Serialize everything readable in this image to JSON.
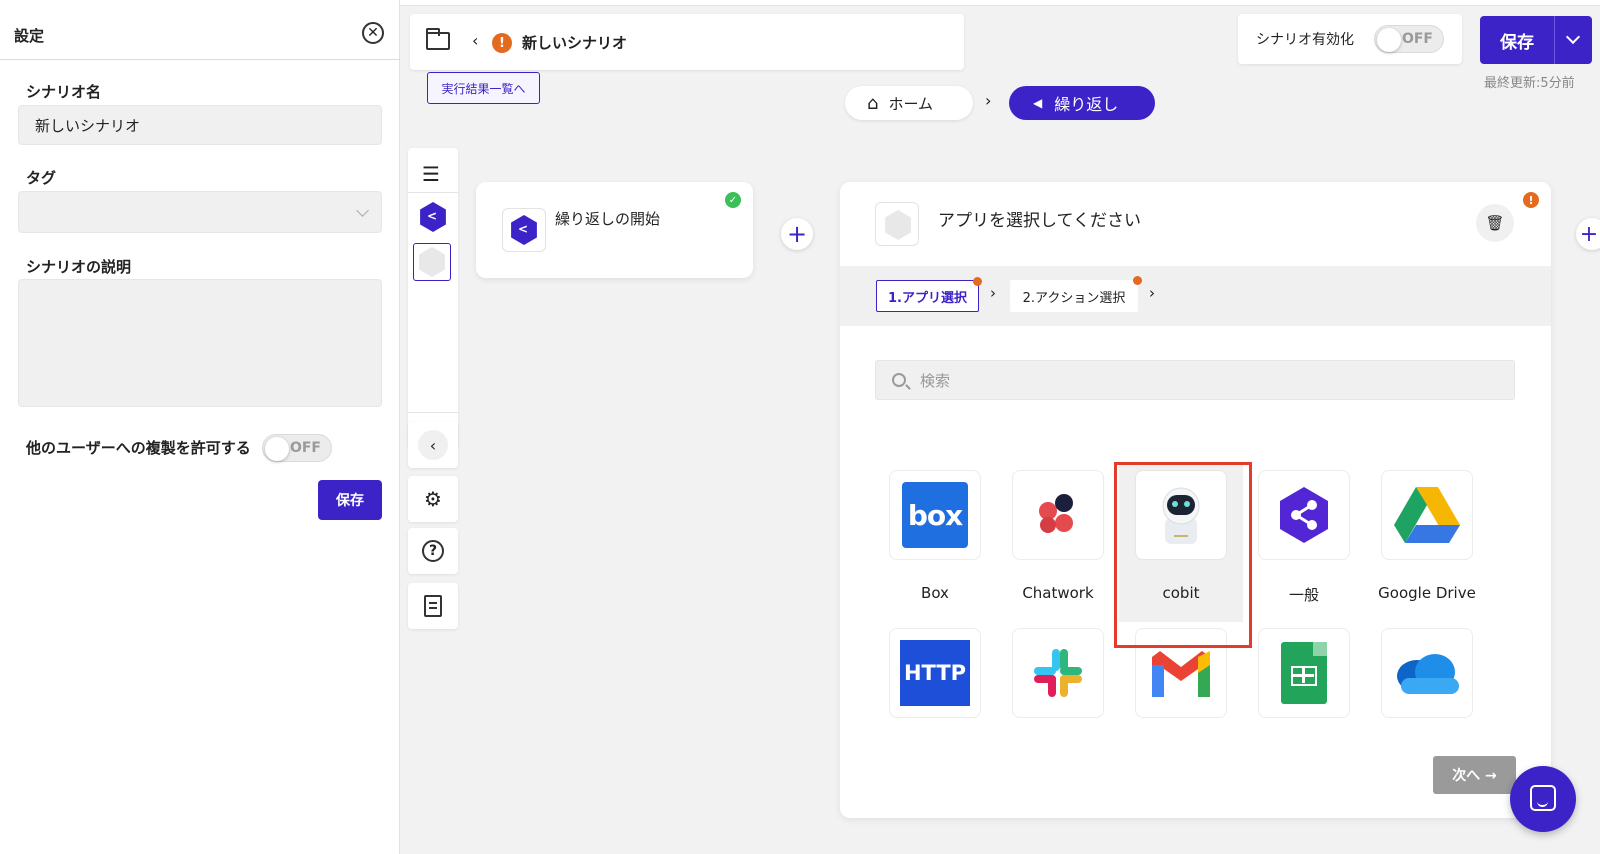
{
  "settings": {
    "title": "設定",
    "scenario_name_label": "シナリオ名",
    "scenario_name_value": "新しいシナリオ",
    "tag_label": "タグ",
    "description_label": "シナリオの説明",
    "description_value": "",
    "allow_copy_label": "他のユーザーへの複製を許可する",
    "allow_copy_toggle": "OFF",
    "save_label": "保存"
  },
  "header": {
    "scenario_name": "新しいシナリオ",
    "warning_mark": "!",
    "results_link": "実行結果一覧へ",
    "enable_label": "シナリオ有効化",
    "enable_toggle": "OFF",
    "save_label": "保存",
    "last_updated": "最終更新:5分前"
  },
  "breadcrumb": {
    "home": "ホーム",
    "current": "繰り返し"
  },
  "flow": {
    "start_node_label": "繰り返しの開始",
    "select_app_title": "アプリを選択してください",
    "steps": [
      {
        "label": "1.アプリ選択"
      },
      {
        "label": "2.アクション選択"
      }
    ],
    "search_placeholder": "検索",
    "next_label": "次へ →"
  },
  "apps": [
    {
      "name": "Box",
      "icon": "box-logo"
    },
    {
      "name": "Chatwork",
      "icon": "chatwork-logo"
    },
    {
      "name": "cobit",
      "icon": "cobit-robot-logo",
      "selected": true
    },
    {
      "name": "一般",
      "icon": "general-hex-logo"
    },
    {
      "name": "Google Drive",
      "icon": "google-drive-logo"
    },
    {
      "name": "",
      "icon": "http-logo",
      "tile_text": "HTTP"
    },
    {
      "name": "",
      "icon": "slack-logo"
    },
    {
      "name": "",
      "icon": "gmail-logo"
    },
    {
      "name": "",
      "icon": "google-sheets-logo"
    },
    {
      "name": "",
      "icon": "onedrive-logo"
    }
  ],
  "tile_text": {
    "box": "box",
    "http": "HTTP"
  },
  "colors": {
    "accent": "#3b23c8",
    "warning": "#e46a1f",
    "success": "#3bbf56",
    "highlight": "#e33b2c"
  }
}
